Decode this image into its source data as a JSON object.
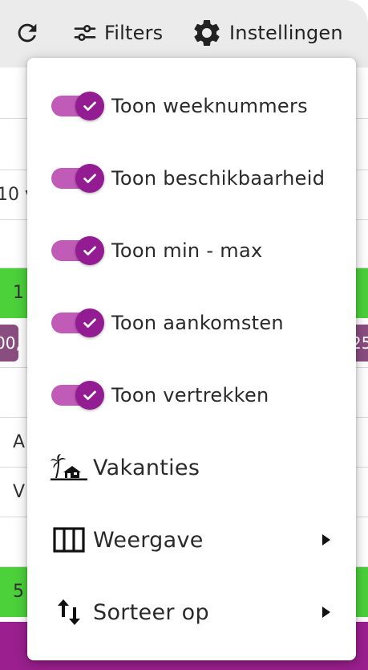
{
  "toolbar": {
    "filters_label": "Filters",
    "settings_label": "Instellingen",
    "refresh_icon": "refresh-icon",
    "filters_icon": "tune-icon",
    "settings_icon": "gear-icon"
  },
  "background": {
    "row_text_1": "10 v",
    "green_row_1": "1",
    "chip_left_1": "00,",
    "chip_right_1": "25",
    "row_text_a": "A",
    "row_text_v": "V",
    "green_row_2": "5"
  },
  "menu": {
    "toggles": [
      {
        "label": "Toon weeknummers",
        "checked": true
      },
      {
        "label": "Toon beschikbaarheid",
        "checked": true
      },
      {
        "label": "Toon min - max",
        "checked": true
      },
      {
        "label": "Toon aankomsten",
        "checked": true
      },
      {
        "label": "Toon vertrekken",
        "checked": true
      }
    ],
    "vacations_label": "Vakanties",
    "view_label": "Weergave",
    "sort_label": "Sorteer op",
    "icons": {
      "vacations": "beach-house-icon",
      "view": "columns-icon",
      "sort": "sort-arrows-icon",
      "submenu": "caret-right-icon"
    }
  },
  "colors": {
    "toggle_track": "#c05cb8",
    "toggle_thumb": "#931c93",
    "green": "#4cd13b",
    "purple": "#9b1f8f"
  }
}
